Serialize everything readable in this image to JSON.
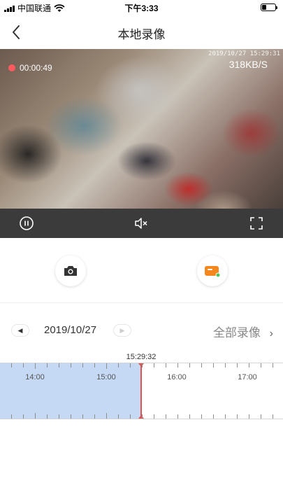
{
  "status": {
    "carrier": "中国联通",
    "time": "下午3:33",
    "battery_level": 0.35
  },
  "nav": {
    "title": "本地录像",
    "back_icon": "chevron-left-icon"
  },
  "video": {
    "timestamp": "2019/10/27 15:29:31",
    "rec_time": "00:00:49",
    "speed": "318KB/S",
    "controls": {
      "pause_icon": "pause-icon",
      "mute_icon": "mute-icon",
      "fullscreen_icon": "fullscreen-icon"
    }
  },
  "actions": {
    "snapshot_icon": "camera-icon",
    "record_icon": "video-record-icon",
    "accent_color": "#f5871f",
    "indicator_color": "#4cc35b"
  },
  "date_row": {
    "date": "2019/10/27",
    "all_recordings": "全部录像",
    "all_recordings_arrow": "›"
  },
  "timeline": {
    "current_time": "15:29:32",
    "hours": [
      "14:00",
      "15:00",
      "16:00",
      "17:00"
    ],
    "recorded_color": "#c5d9f5",
    "cursor_color": "#e05252"
  }
}
